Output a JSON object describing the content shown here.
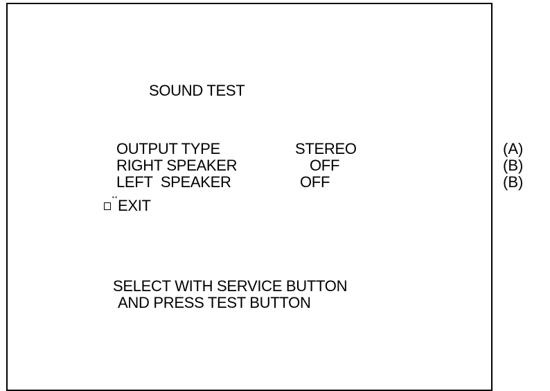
{
  "screen": {
    "title": "SOUND TEST",
    "menu": [
      {
        "label": "OUTPUT TYPE",
        "value": "STEREO",
        "note": "(A)"
      },
      {
        "label": "RIGHT SPEAKER",
        "value": "OFF",
        "note": "(B)"
      },
      {
        "label": "LEFT  SPEAKER",
        "value": "OFF",
        "note": "(B)"
      }
    ],
    "exit_label": "EXIT",
    "cursor_marks": "¨",
    "instructions": {
      "line1": "SELECT WITH SERVICE BUTTON",
      "line2": "AND PRESS TEST BUTTON"
    }
  }
}
